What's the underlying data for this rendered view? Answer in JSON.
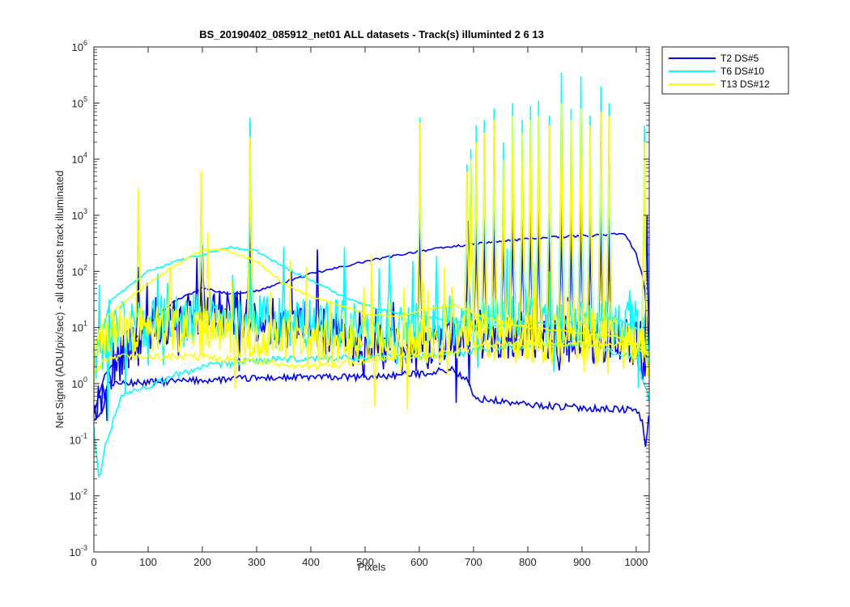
{
  "chart_data": {
    "type": "line",
    "title": "BS_20190402_085912_net01 ALL datasets - Track(s) illuminted 2   6  13",
    "xlabel": "Pixels",
    "ylabel": "Net Signal (ADU/pix/sec) - all datasets track illuminated",
    "xlim": [
      0,
      1024
    ],
    "ylim": [
      0.001,
      1000000
    ],
    "yscale": "log",
    "grid": false,
    "legend_position": "outside-top-right",
    "x_ticks": [
      0,
      100,
      200,
      300,
      400,
      500,
      600,
      700,
      800,
      900,
      1000
    ],
    "y_tick_base": "10",
    "y_tick_exponents": [
      "-3",
      "-2",
      "-1",
      "0",
      "1",
      "2",
      "3",
      "4",
      "5",
      "6"
    ],
    "series": [
      {
        "name": "T2 DS#5",
        "color": "#0000ff",
        "background": [
          [
            0,
            0.25
          ],
          [
            15,
            0.3
          ],
          [
            25,
            1.0
          ],
          [
            100,
            1.05
          ],
          [
            200,
            1.15
          ],
          [
            300,
            1.25
          ],
          [
            400,
            1.3
          ],
          [
            500,
            1.3
          ],
          [
            600,
            1.5
          ],
          [
            660,
            1.8
          ],
          [
            690,
            1.1
          ],
          [
            700,
            0.55
          ],
          [
            800,
            0.42
          ],
          [
            900,
            0.37
          ],
          [
            1000,
            0.34
          ],
          [
            1012,
            0.2
          ],
          [
            1018,
            0.07
          ],
          [
            1024,
            0.3
          ]
        ],
        "envelope": [
          [
            0,
            0.3
          ],
          [
            20,
            1.5
          ],
          [
            60,
            4
          ],
          [
            100,
            12
          ],
          [
            150,
            30
          ],
          [
            200,
            50
          ],
          [
            250,
            40
          ],
          [
            300,
            45
          ],
          [
            400,
            90
          ],
          [
            500,
            150
          ],
          [
            600,
            230
          ],
          [
            700,
            310
          ],
          [
            800,
            380
          ],
          [
            900,
            430
          ],
          [
            960,
            460
          ],
          [
            980,
            460
          ],
          [
            1000,
            200
          ],
          [
            1015,
            60
          ],
          [
            1024,
            4
          ]
        ],
        "structure": [
          [
            0,
            0.3
          ],
          [
            20,
            1.2
          ],
          [
            50,
            3
          ],
          [
            100,
            7
          ],
          [
            150,
            13
          ],
          [
            200,
            20
          ],
          [
            300,
            15
          ],
          [
            400,
            10
          ],
          [
            480,
            5
          ],
          [
            560,
            4
          ],
          [
            620,
            5
          ],
          [
            690,
            7
          ],
          [
            700,
            8
          ],
          [
            800,
            7
          ],
          [
            900,
            6
          ],
          [
            1000,
            5
          ],
          [
            1024,
            2
          ]
        ],
        "peaks": [
          [
            82,
            120
          ],
          [
            200,
            300
          ],
          [
            287,
            1100
          ],
          [
            490,
            20
          ],
          [
            601,
            2000
          ],
          [
            690,
            800
          ],
          [
            705,
            1000
          ],
          [
            720,
            900
          ],
          [
            738,
            1200
          ],
          [
            755,
            1000
          ],
          [
            772,
            1300
          ],
          [
            790,
            800
          ],
          [
            805,
            1500
          ],
          [
            820,
            1300
          ],
          [
            840,
            1000
          ],
          [
            862,
            1800
          ],
          [
            880,
            900
          ],
          [
            898,
            2000
          ],
          [
            915,
            1000
          ],
          [
            935,
            1700
          ],
          [
            950,
            900
          ],
          [
            1020,
            1000
          ]
        ]
      },
      {
        "name": "T6 DS#10",
        "color": "#00ffff",
        "background": [
          [
            0,
            0.15
          ],
          [
            10,
            0.02
          ],
          [
            20,
            0.07
          ],
          [
            30,
            0.15
          ],
          [
            50,
            0.6
          ],
          [
            100,
            0.9
          ],
          [
            150,
            1.4
          ],
          [
            200,
            2.0
          ],
          [
            300,
            2.6
          ],
          [
            400,
            2.8
          ],
          [
            500,
            2.9
          ],
          [
            600,
            3.1
          ],
          [
            690,
            3.5
          ],
          [
            700,
            4
          ],
          [
            800,
            5
          ],
          [
            900,
            5
          ],
          [
            1000,
            3
          ],
          [
            1024,
            0.5
          ]
        ],
        "envelope": [
          [
            0,
            2
          ],
          [
            30,
            30
          ],
          [
            60,
            50
          ],
          [
            100,
            100
          ],
          [
            150,
            150
          ],
          [
            200,
            200
          ],
          [
            250,
            270
          ],
          [
            300,
            230
          ],
          [
            350,
            120
          ],
          [
            400,
            70
          ],
          [
            450,
            40
          ],
          [
            500,
            25
          ],
          [
            560,
            18
          ],
          [
            620,
            15
          ],
          [
            690,
            12
          ],
          [
            720,
            10
          ],
          [
            800,
            12
          ],
          [
            900,
            12
          ],
          [
            960,
            15
          ],
          [
            1000,
            10
          ],
          [
            1024,
            3
          ]
        ],
        "structure": [
          [
            0,
            3
          ],
          [
            50,
            10
          ],
          [
            100,
            13
          ],
          [
            200,
            14
          ],
          [
            300,
            14
          ],
          [
            400,
            12
          ],
          [
            500,
            11
          ],
          [
            600,
            10
          ],
          [
            690,
            12
          ],
          [
            700,
            15
          ],
          [
            800,
            14
          ],
          [
            900,
            12
          ],
          [
            1000,
            11
          ],
          [
            1024,
            3
          ]
        ],
        "peaks": [
          [
            82,
            2500
          ],
          [
            198,
            6000
          ],
          [
            288,
            55000
          ],
          [
            358,
            20
          ],
          [
            545,
            200
          ],
          [
            601,
            55000
          ],
          [
            688,
            8000
          ],
          [
            695,
            15000
          ],
          [
            705,
            40000
          ],
          [
            720,
            50000
          ],
          [
            738,
            80000
          ],
          [
            755,
            20000
          ],
          [
            772,
            100000
          ],
          [
            790,
            50000
          ],
          [
            805,
            90000
          ],
          [
            820,
            110000
          ],
          [
            840,
            60000
          ],
          [
            862,
            350000
          ],
          [
            880,
            80000
          ],
          [
            898,
            300000
          ],
          [
            915,
            60000
          ],
          [
            935,
            200000
          ],
          [
            950,
            100000
          ],
          [
            1015,
            40000
          ]
        ]
      },
      {
        "name": "T13 DS#12",
        "color": "#ffff00",
        "background": [
          [
            0,
            1.5
          ],
          [
            20,
            2.5
          ],
          [
            50,
            3
          ],
          [
            100,
            3
          ],
          [
            200,
            3
          ],
          [
            300,
            2.5
          ],
          [
            400,
            2
          ],
          [
            500,
            2.5
          ],
          [
            560,
            3
          ],
          [
            600,
            3
          ],
          [
            690,
            4
          ],
          [
            700,
            5
          ],
          [
            800,
            5
          ],
          [
            900,
            5
          ],
          [
            1000,
            5
          ],
          [
            1024,
            3
          ]
        ],
        "envelope": [
          [
            0,
            4
          ],
          [
            20,
            15
          ],
          [
            60,
            30
          ],
          [
            100,
            60
          ],
          [
            150,
            130
          ],
          [
            200,
            240
          ],
          [
            240,
            250
          ],
          [
            260,
            210
          ],
          [
            300,
            150
          ],
          [
            350,
            60
          ],
          [
            400,
            35
          ],
          [
            450,
            25
          ],
          [
            500,
            18
          ],
          [
            560,
            15
          ],
          [
            600,
            20
          ],
          [
            660,
            25
          ],
          [
            690,
            20
          ],
          [
            720,
            15
          ],
          [
            800,
            10
          ],
          [
            900,
            8
          ],
          [
            960,
            7
          ],
          [
            1000,
            5
          ],
          [
            1024,
            3
          ]
        ],
        "structure": [
          [
            0,
            3
          ],
          [
            50,
            10
          ],
          [
            100,
            10
          ],
          [
            200,
            8
          ],
          [
            300,
            8
          ],
          [
            400,
            6
          ],
          [
            500,
            6
          ],
          [
            600,
            6
          ],
          [
            700,
            8
          ],
          [
            800,
            6
          ],
          [
            900,
            6
          ],
          [
            1000,
            5
          ],
          [
            1024,
            3
          ]
        ],
        "peaks": [
          [
            82,
            3000
          ],
          [
            198,
            6000
          ],
          [
            210,
            500
          ],
          [
            288,
            25000
          ],
          [
            601,
            45000
          ],
          [
            688,
            6000
          ],
          [
            695,
            10000
          ],
          [
            705,
            20000
          ],
          [
            720,
            30000
          ],
          [
            738,
            50000
          ],
          [
            755,
            10000
          ],
          [
            772,
            60000
          ],
          [
            790,
            30000
          ],
          [
            805,
            50000
          ],
          [
            820,
            60000
          ],
          [
            840,
            40000
          ],
          [
            862,
            100000
          ],
          [
            880,
            50000
          ],
          [
            898,
            80000
          ],
          [
            915,
            40000
          ],
          [
            935,
            70000
          ],
          [
            950,
            60000
          ],
          [
            1015,
            20000
          ]
        ]
      }
    ]
  }
}
